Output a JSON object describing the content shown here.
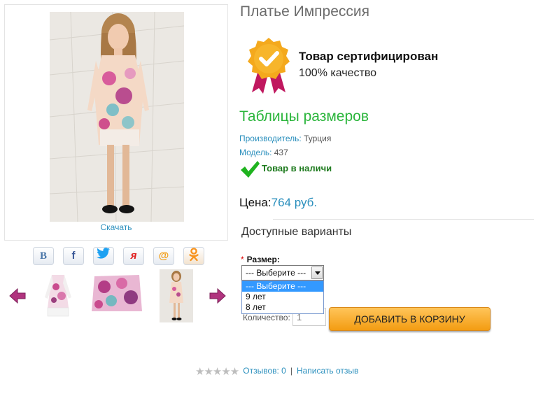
{
  "product": {
    "title": "Платье Импрессия",
    "download_label": "Скачать",
    "certificate": {
      "title": "Товар сертифицирован",
      "subtitle": "100% качество"
    },
    "size_table_link": "Таблицы размеров",
    "manufacturer": {
      "label": "Производитель:",
      "value": "Турция"
    },
    "model": {
      "label": "Модель:",
      "value": "437"
    },
    "stock_status": "Товар в наличи",
    "price": {
      "label": "Цена:",
      "value": "764 руб."
    }
  },
  "share": {
    "buttons": [
      {
        "name": "vk",
        "glyph": "B",
        "color": "#4a76a8"
      },
      {
        "name": "facebook",
        "glyph": "f",
        "color": "#3b5998"
      },
      {
        "name": "twitter",
        "glyph": "t",
        "color": "#1da1f2"
      },
      {
        "name": "moi-krug",
        "glyph": "я",
        "color": "#e02020"
      },
      {
        "name": "mail",
        "glyph": "@",
        "color": "#f39c12"
      },
      {
        "name": "odnoklassniki",
        "glyph": "ок",
        "color": "#f7931e"
      }
    ]
  },
  "options": {
    "title": "Доступные варианты",
    "size_label": "Размер:",
    "required_mark": "*",
    "selected": "--- Выберите ---",
    "choices": [
      "--- Выберите ---",
      "9 лет",
      "8 лет"
    ]
  },
  "cart": {
    "quantity_label": "Количество:",
    "quantity_value": "1",
    "add_button": "ДОБАВИТЬ В КОРЗИНУ"
  },
  "reviews": {
    "rating": 0,
    "count_label": "Отзывов: 0",
    "separator": "|",
    "write_label": "Написать отзыв",
    "stars": "★★★★★"
  },
  "colors": {
    "link": "#2a8fbd",
    "green": "#2ab53b",
    "button_orange": "#f39c12"
  }
}
